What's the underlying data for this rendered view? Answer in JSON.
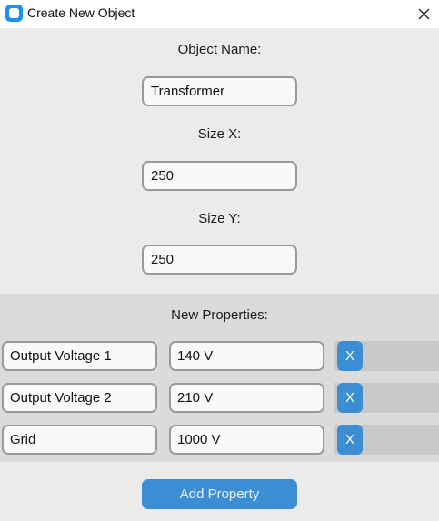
{
  "window": {
    "title": "Create New Object",
    "icon": "app-icon",
    "close_icon": "close-icon"
  },
  "form": {
    "name_label": "Object Name:",
    "name_value": "Transformer",
    "size_x_label": "Size X:",
    "size_x_value": "250",
    "size_y_label": "Size Y:",
    "size_y_value": "250"
  },
  "properties": {
    "title": "New Properties:",
    "items": [
      {
        "name": "Output Voltage 1",
        "value": "140 V",
        "remove_label": "X"
      },
      {
        "name": "Output Voltage 2",
        "value": "210 V",
        "remove_label": "X"
      },
      {
        "name": "Grid",
        "value": "1000 V",
        "remove_label": "X"
      }
    ],
    "add_label": "Add Property"
  },
  "colors": {
    "accent": "#3b8ed4",
    "background": "#ebebeb",
    "panel": "#dbdbdb"
  }
}
